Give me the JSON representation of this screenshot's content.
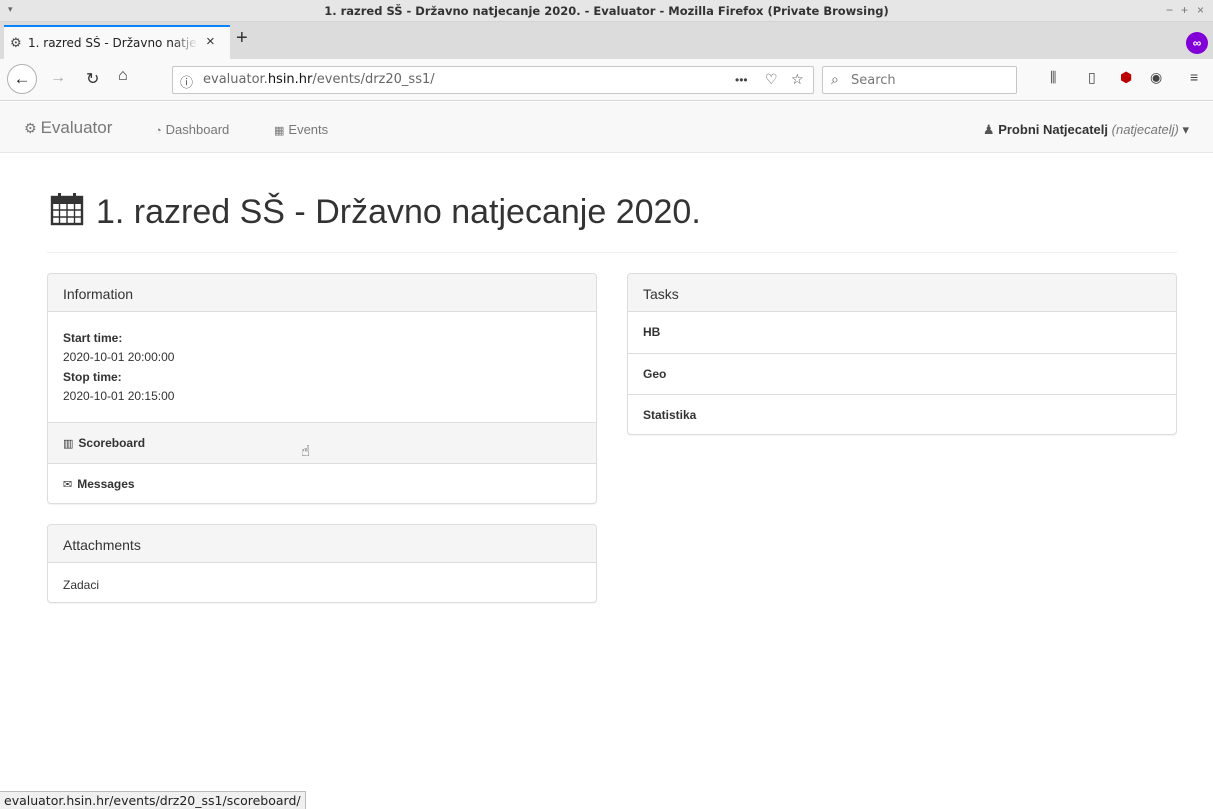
{
  "window": {
    "title": "1. razred SŠ - Državno natjecanje 2020. - Evaluator - Mozilla Firefox (Private Browsing)",
    "controls": [
      "−",
      "+",
      "×"
    ]
  },
  "tab": {
    "title": "1. razred SŠ - Državno natjecanje 2020.",
    "close": "×",
    "new_tab": "+"
  },
  "urlbar": {
    "url_prefix": "evaluator.",
    "url_domain": "hsin.hr",
    "url_path": "/events/drz20_ss1/",
    "page_actions": "•••"
  },
  "search": {
    "placeholder": "Search"
  },
  "app_nav": {
    "brand": "Evaluator",
    "links": [
      "Dashboard",
      "Events"
    ],
    "user_name": "Probni Natjecatelj",
    "user_login": "(natjecatelj)"
  },
  "page": {
    "title": "1. razred SŠ - Državno natjecanje 2020."
  },
  "information": {
    "heading": "Information",
    "start_label": "Start time:",
    "start_value": "2020-10-01 20:00:00",
    "stop_label": "Stop time:",
    "stop_value": "2020-10-01 20:15:00",
    "links": [
      "Scoreboard",
      "Messages"
    ]
  },
  "attachments": {
    "heading": "Attachments",
    "items": [
      "Zadaci"
    ]
  },
  "tasks": {
    "heading": "Tasks",
    "items": [
      "HB",
      "Geo",
      "Statistika"
    ]
  },
  "status_bar": "evaluator.hsin.hr/events/drz20_ss1/scoreboard/",
  "colors": {
    "accent": "#0a84ff",
    "private": "#8000d7",
    "panel_heading": "#f5f5f5"
  }
}
